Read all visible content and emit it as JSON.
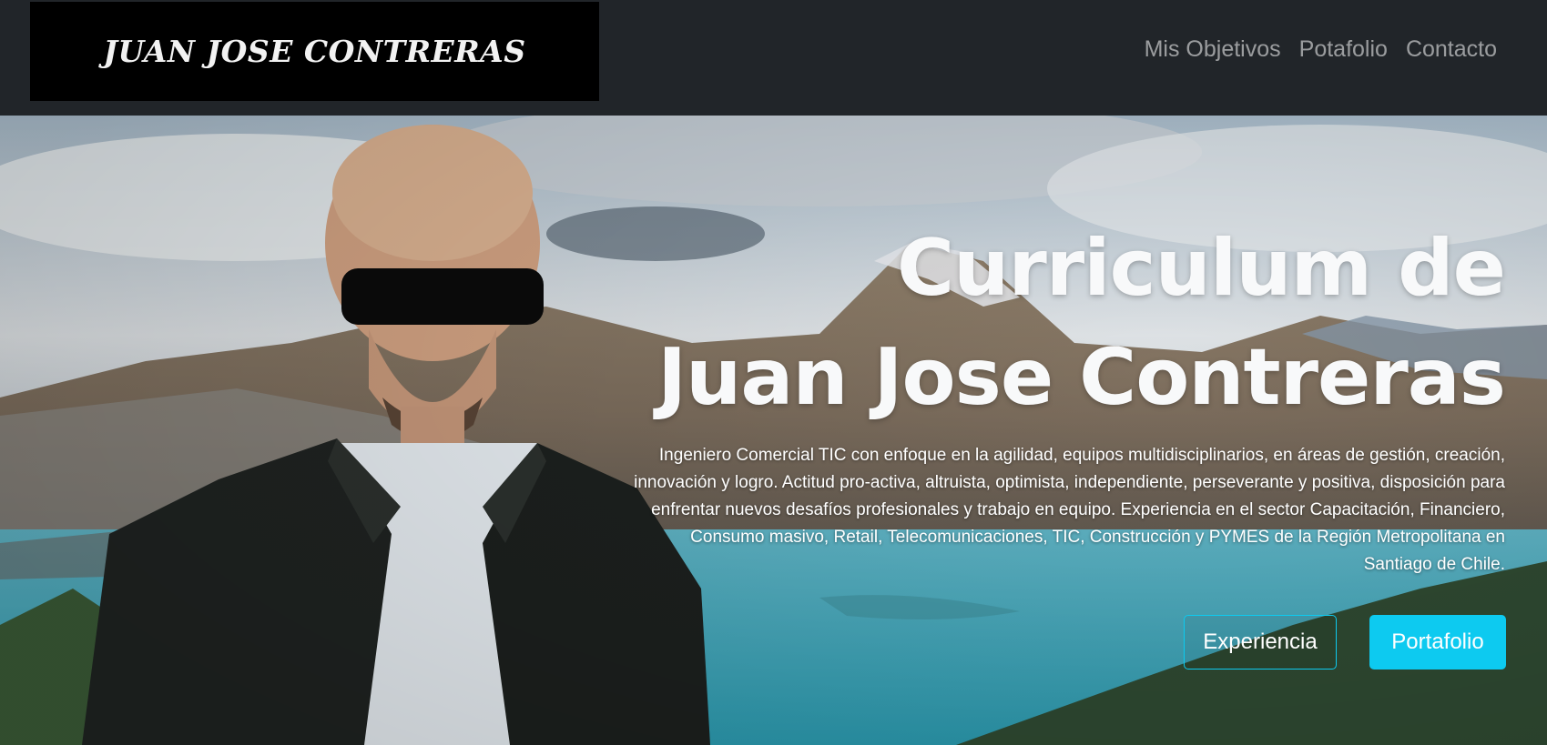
{
  "navbar": {
    "brand": "JUAN JOSE CONTRERAS",
    "links": [
      "Mis Objetivos",
      "Potafolio",
      "Contacto"
    ]
  },
  "hero": {
    "title_line1": "Curriculum de",
    "title_line2": "Juan Jose Contreras",
    "description": "Ingeniero Comercial TIC con enfoque en la agilidad, equipos multidisciplinarios, en áreas de gestión, creación, innovación y logro. Actitud pro-activa, altruista, optimista, independiente, perseverante y positiva, disposición para enfrentar nuevos desafíos profesionales y trabajo en equipo. Experiencia en el sector Capacitación, Financiero, Consumo masivo, Retail, Telecomunicaciones, TIC, Construcción y PYMES de la Región Metropolitana en Santiago de Chile.",
    "buttons": {
      "experience": "Experiencia",
      "portfolio": "Portafolio"
    }
  },
  "colors": {
    "navbar_bg": "#212529",
    "accent": "#0dcaf0",
    "nav_link": "rgba(255,255,255,0.55)"
  }
}
